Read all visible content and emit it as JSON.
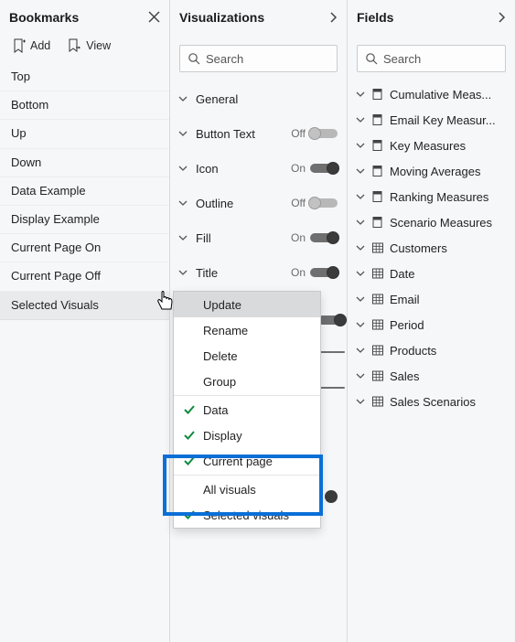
{
  "bookmarks": {
    "title": "Bookmarks",
    "add_label": "Add",
    "view_label": "View",
    "items": [
      "Top",
      "Bottom",
      "Up",
      "Down",
      "Data Example",
      "Display Example",
      "Current Page On",
      "Current Page Off",
      "Selected Visuals"
    ],
    "selected_index": 8
  },
  "visualizations": {
    "title": "Visualizations",
    "search_placeholder": "Search",
    "format_options": [
      {
        "name": "General",
        "toggle": null
      },
      {
        "name": "Button Text",
        "toggle": "Off"
      },
      {
        "name": "Icon",
        "toggle": "On"
      },
      {
        "name": "Outline",
        "toggle": "Off"
      },
      {
        "name": "Fill",
        "toggle": "On"
      },
      {
        "name": "Title",
        "toggle": "On"
      }
    ]
  },
  "fields": {
    "title": "Fields",
    "search_placeholder": "Search",
    "items": [
      {
        "name": "Cumulative Meas...",
        "type": "measure"
      },
      {
        "name": "Email Key Measur...",
        "type": "measure"
      },
      {
        "name": "Key Measures",
        "type": "measure"
      },
      {
        "name": "Moving Averages",
        "type": "measure"
      },
      {
        "name": "Ranking Measures",
        "type": "measure"
      },
      {
        "name": "Scenario Measures",
        "type": "measure"
      },
      {
        "name": "Customers",
        "type": "table"
      },
      {
        "name": "Date",
        "type": "table"
      },
      {
        "name": "Email",
        "type": "table"
      },
      {
        "name": "Period",
        "type": "table"
      },
      {
        "name": "Products",
        "type": "table"
      },
      {
        "name": "Sales",
        "type": "table"
      },
      {
        "name": "Sales Scenarios",
        "type": "table"
      }
    ]
  },
  "context_menu": {
    "items": [
      {
        "label": "Update",
        "checked": false,
        "group": 1,
        "highlighted": true
      },
      {
        "label": "Rename",
        "checked": false,
        "group": 1
      },
      {
        "label": "Delete",
        "checked": false,
        "group": 1
      },
      {
        "label": "Group",
        "checked": false,
        "group": 1
      },
      {
        "label": "Data",
        "checked": true,
        "group": 2
      },
      {
        "label": "Display",
        "checked": true,
        "group": 2
      },
      {
        "label": "Current page",
        "checked": true,
        "group": 2
      },
      {
        "label": "All visuals",
        "checked": false,
        "group": 3
      },
      {
        "label": "Selected visuals",
        "checked": true,
        "group": 3
      }
    ]
  }
}
